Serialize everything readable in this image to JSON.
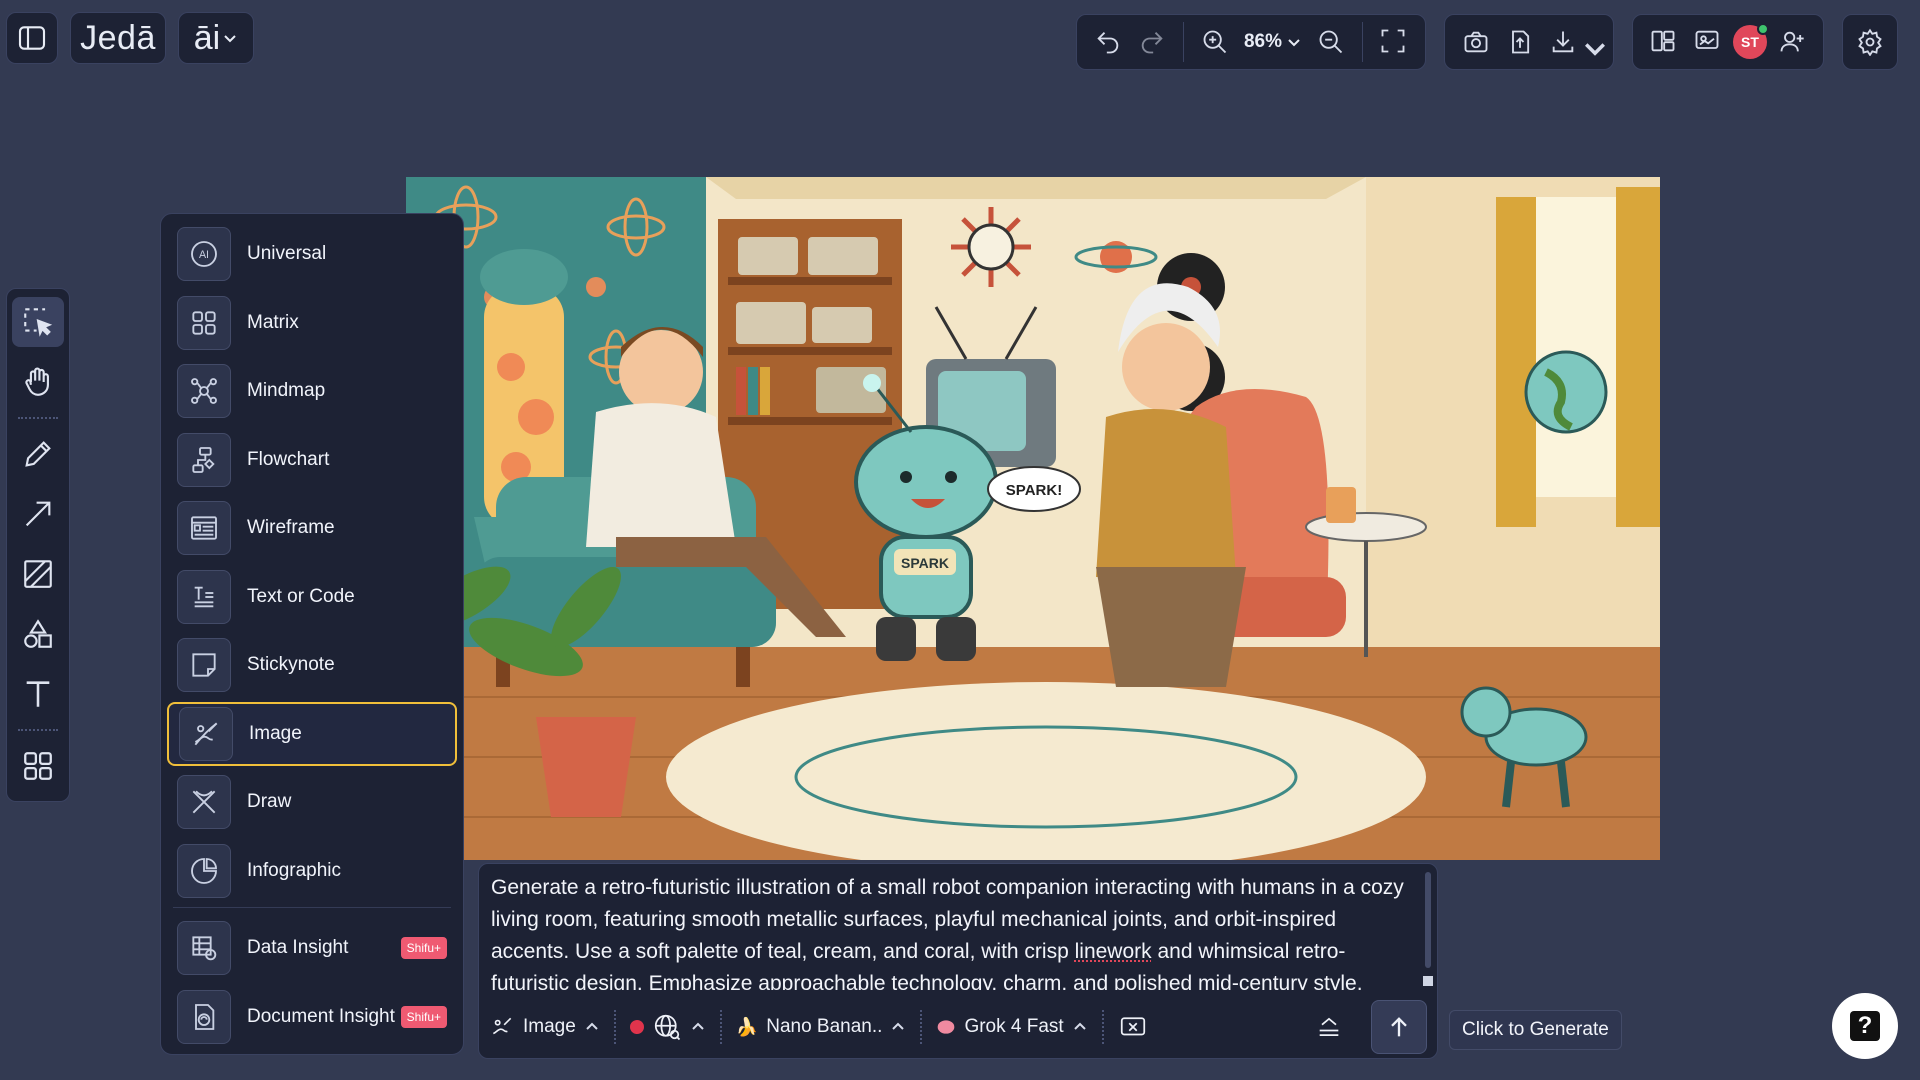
{
  "app": {
    "logo_text": "Jedā",
    "ai_label": "āi"
  },
  "toolbar": {
    "zoom": "86%"
  },
  "user": {
    "initials": "ST"
  },
  "ai_menu": {
    "items": [
      {
        "label": "Universal",
        "icon": "ai-chip-icon"
      },
      {
        "label": "Matrix",
        "icon": "grid-icon"
      },
      {
        "label": "Mindmap",
        "icon": "mindmap-icon"
      },
      {
        "label": "Flowchart",
        "icon": "flowchart-icon"
      },
      {
        "label": "Wireframe",
        "icon": "wireframe-icon"
      },
      {
        "label": "Text or Code",
        "icon": "text-code-icon"
      },
      {
        "label": "Stickynote",
        "icon": "stickynote-icon"
      },
      {
        "label": "Image",
        "icon": "image-brush-icon",
        "selected": true
      },
      {
        "label": "Draw",
        "icon": "draw-icon"
      },
      {
        "label": "Infographic",
        "icon": "infographic-icon"
      }
    ],
    "premium_items": [
      {
        "label": "Data Insight",
        "badge": "Shifu+",
        "icon": "data-insight-icon"
      },
      {
        "label": "Document Insight",
        "badge": "Shifu+",
        "icon": "document-insight-icon"
      }
    ]
  },
  "prompt": {
    "text_before": "Generate a retro-futuristic illustration of a small robot companion interacting with humans in a cozy living room, featuring smooth metallic surfaces, playful mechanical joints, and orbit-inspired accents. Use a soft palette of teal, cream, and coral, with crisp ",
    "text_underlined": "linework",
    "text_after": " and whimsical retro-futuristic design. Emphasize approachable technology, charm, and polished mid-century style.",
    "mode_label": "Image",
    "image_model": "Nano Banan..",
    "text_model": "Grok 4 Fast"
  },
  "tooltip": "Click to Generate",
  "illustration": {
    "robot_badge": "SPARK",
    "speech_bubble": "SPARK!"
  },
  "colors": {
    "background": "#333a52",
    "panel": "#1d2234",
    "selected_border": "#f0bf3a",
    "badge": "#ef5a72",
    "avatar": "#e0475a"
  }
}
